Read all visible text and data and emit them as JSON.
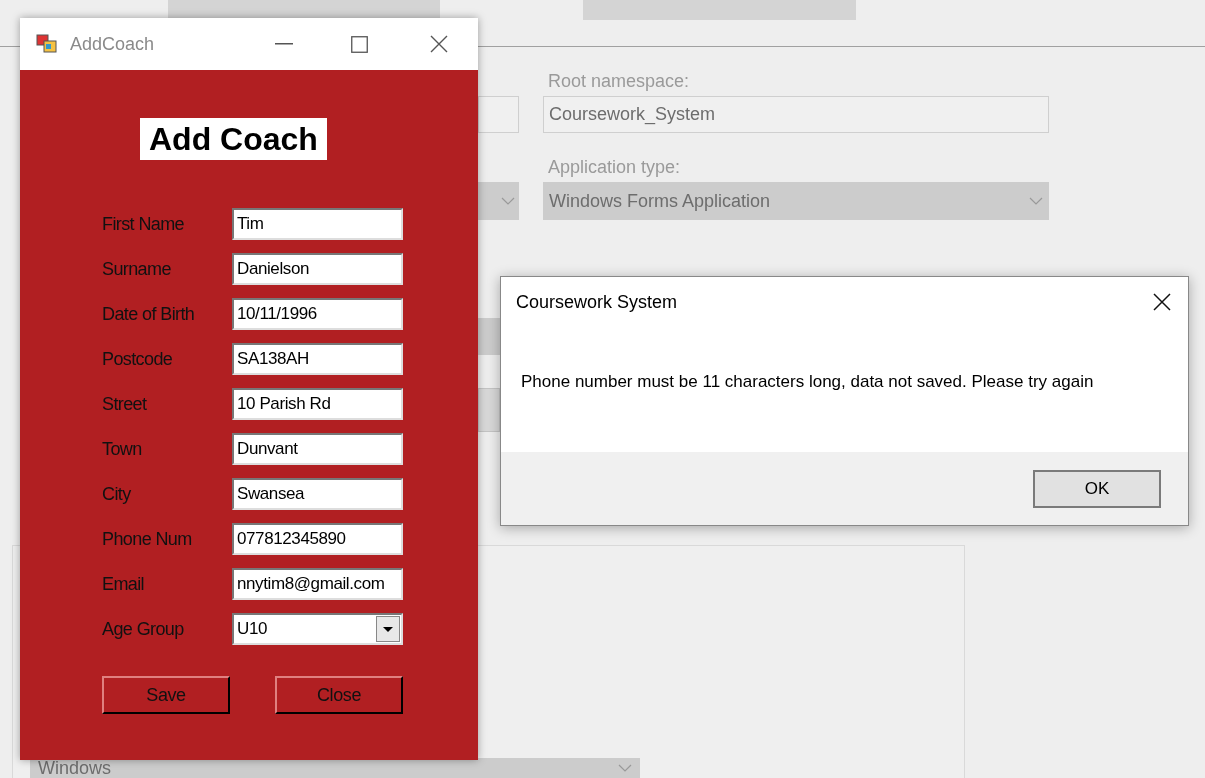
{
  "background": {
    "root_namespace_label": "Root namespace:",
    "root_namespace_value": "Coursework_System",
    "application_type_label": "Application type:",
    "application_type_value": "Windows Forms Application",
    "target_value": "Windows"
  },
  "add_coach_window": {
    "title": "AddCoach",
    "heading": "Add Coach",
    "fields": [
      {
        "label": "First Name",
        "value": "Tim",
        "kind": "text"
      },
      {
        "label": "Surname",
        "value": "Danielson",
        "kind": "text"
      },
      {
        "label": "Date of Birth",
        "value": "10/11/1996",
        "kind": "text"
      },
      {
        "label": "Postcode",
        "value": "SA138AH",
        "kind": "text"
      },
      {
        "label": "Street",
        "value": "10 Parish Rd",
        "kind": "text"
      },
      {
        "label": "Town",
        "value": "Dunvant",
        "kind": "text"
      },
      {
        "label": "City",
        "value": "Swansea",
        "kind": "text"
      },
      {
        "label": "Phone Num",
        "value": "077812345890",
        "kind": "text"
      },
      {
        "label": "Email",
        "value": "nnytim8@gmail.com",
        "kind": "text"
      },
      {
        "label": "Age Group",
        "value": "U10",
        "kind": "dropdown"
      }
    ],
    "buttons": [
      "Save",
      "Close"
    ]
  },
  "message_box": {
    "title": "Coursework System",
    "message": "Phone number must be 11 characters long, data not saved. Please try again",
    "buttons": [
      "OK"
    ]
  }
}
